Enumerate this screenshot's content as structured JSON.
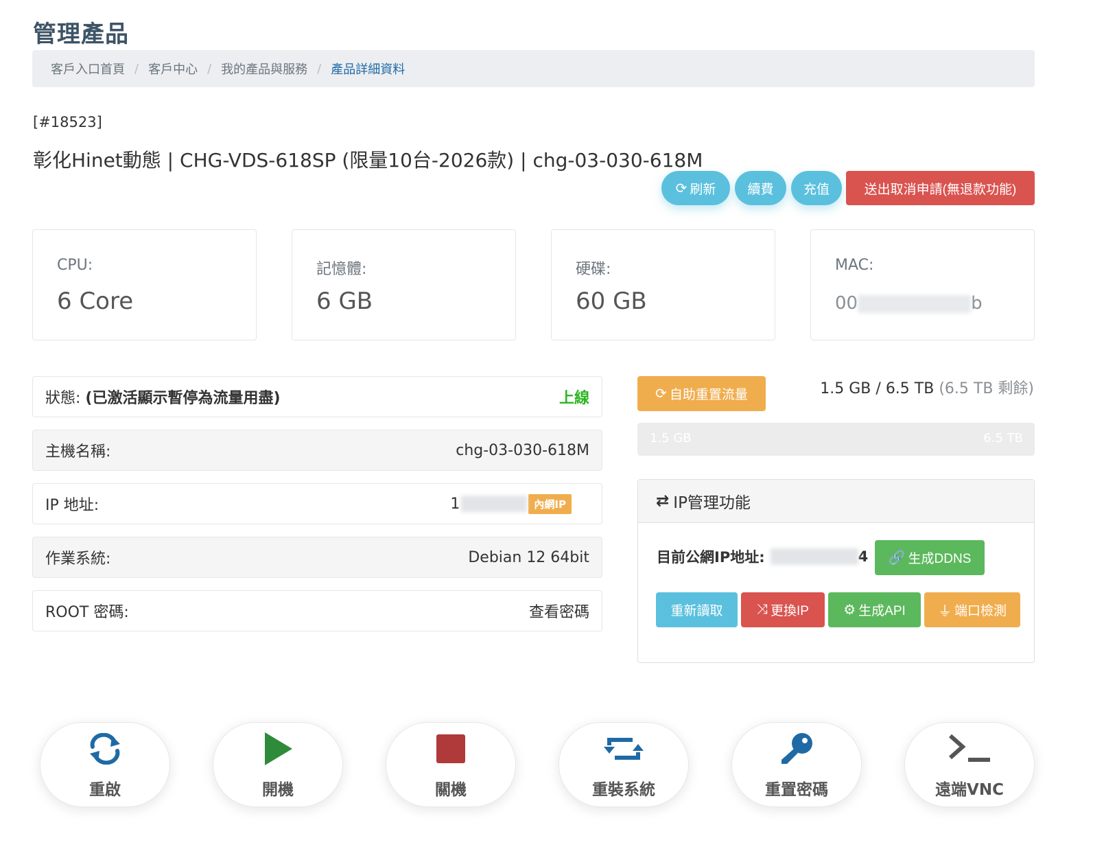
{
  "page_title": "管理產品",
  "breadcrumb": {
    "items": [
      "客戶入口首頁",
      "客戶中心",
      "我的產品與服務"
    ],
    "active": "產品詳細資料",
    "separator": "/"
  },
  "product": {
    "id": "[#18523]",
    "name": "彰化Hinet動態 | CHG-VDS-618SP (限量10台-2026款) | chg-03-030-618M"
  },
  "actions": {
    "refresh": "刷新",
    "renew": "續費",
    "recharge": "充值",
    "cancel": "送出取消申請(無退款功能)"
  },
  "specs": {
    "cpu_label": "CPU:",
    "cpu_value": "6 Core",
    "memory_label": "記憶體:",
    "memory_value": "6 GB",
    "disk_label": "硬碟:",
    "disk_value": "60 GB",
    "mac_label": "MAC:",
    "mac_prefix": "00",
    "mac_suffix": "b"
  },
  "info": {
    "status_label": "狀態:",
    "status_note": "(已激活顯示暫停為流量用盡)",
    "status_value": "上線",
    "hostname_label": "主機名稱:",
    "hostname_value": "chg-03-030-618M",
    "ip_label": "IP 地址:",
    "ip_prefix": "1",
    "ip_badge": "內網IP",
    "os_label": "作業系統:",
    "os_value": "Debian 12 64bit",
    "root_label": "ROOT 密碼:",
    "root_value": "查看密碼"
  },
  "traffic": {
    "reset_button": "自助重置流量",
    "used": "1.5 GB",
    "total": "6.5 TB",
    "remaining": "(6.5 TB 剩餘)",
    "progress_fraction": 0.0002,
    "bar_left_label": "1.5 GB",
    "bar_right_label": "6.5 TB"
  },
  "ip_panel": {
    "title": "IP管理功能",
    "public_ip_label": "目前公網IP地址:",
    "public_ip_suffix": "4",
    "ddns_button": "生成DDNS",
    "reread_button": "重新讀取",
    "change_ip_button": "更換IP",
    "api_button": "生成API",
    "port_button": "端口檢測"
  },
  "power_actions": [
    {
      "label": "重啟",
      "icon": "restart-icon",
      "color": "#1f6aa5"
    },
    {
      "label": "開機",
      "icon": "play-icon",
      "color": "#2e8b3a"
    },
    {
      "label": "關機",
      "icon": "stop-icon",
      "color": "#b0393a"
    },
    {
      "label": "重裝系統",
      "icon": "retweet-icon",
      "color": "#1f6aa5"
    },
    {
      "label": "重置密碼",
      "icon": "key-icon",
      "color": "#1f6aa5"
    },
    {
      "label": "遠端VNC",
      "icon": "terminal-icon",
      "color": "#555555"
    }
  ],
  "colors": {
    "info": "#5bc0de",
    "danger": "#d9534f",
    "success": "#5cb85c",
    "warning": "#f0ad4e",
    "online": "#2bb521"
  }
}
